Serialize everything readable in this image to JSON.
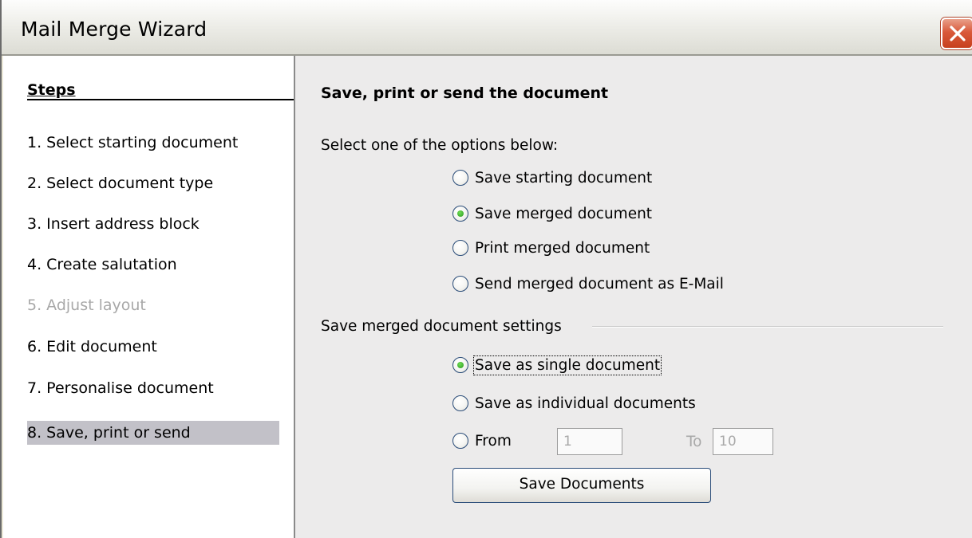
{
  "window": {
    "title": "Mail Merge Wizard"
  },
  "steps": {
    "header": "Steps",
    "items": [
      {
        "label": "1.  Select starting document"
      },
      {
        "label": "2.  Select document type"
      },
      {
        "label": "3.  Insert address block"
      },
      {
        "label": "4.  Create salutation"
      },
      {
        "label": "5.  Adjust layout"
      },
      {
        "label": "6.  Edit document"
      },
      {
        "label": "7.  Personalise document"
      },
      {
        "label": "8.  Save, print or send"
      }
    ]
  },
  "main": {
    "heading": "Save, print or send the document",
    "options_prompt": "Select one of the options below:",
    "options": [
      {
        "label": "Save starting document",
        "checked": false
      },
      {
        "label": "Save merged document",
        "checked": true
      },
      {
        "label": "Print merged document",
        "checked": false
      },
      {
        "label": "Send merged document as E-Mail",
        "checked": false
      }
    ],
    "settings_group": "Save merged document settings",
    "settings": [
      {
        "label": "Save as single document",
        "checked": true
      },
      {
        "label": "Save as individual documents",
        "checked": false
      },
      {
        "label": "From",
        "checked": false
      }
    ],
    "from_value": "1",
    "to_label": "To",
    "to_value": "10",
    "save_button": "Save Documents"
  }
}
